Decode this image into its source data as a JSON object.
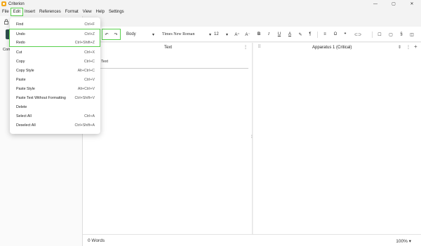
{
  "app": {
    "title": "Criterion",
    "brand_color": "#f2a81d",
    "highlight_color": "#57d04b",
    "window_controls": [
      "minimize-icon",
      "maximize-icon",
      "close-icon"
    ]
  },
  "menubar": {
    "items": [
      "File",
      "Edit",
      "Insert",
      "References",
      "Format",
      "View",
      "Help",
      "Settings"
    ],
    "active": "Edit"
  },
  "sidebar": {
    "label": "Com"
  },
  "toolbar": {
    "style": "Body",
    "font": "Times New Roman",
    "size": "12",
    "icons": [
      "undo-icon",
      "redo-icon",
      "increase-font-icon",
      "decrease-font-icon",
      "bold-icon",
      "italic-icon",
      "underline-icon",
      "font-color-icon",
      "highlight-icon",
      "pilcrow-icon",
      "align-icon",
      "omega-icon",
      "quote-icon",
      "link-icon",
      "comment-icon",
      "box-icon",
      "note-icon",
      "code-icon"
    ],
    "glyphs": {
      "increase": "A⁺",
      "decrease": "A⁻",
      "bold": "B",
      "italic": "I",
      "underline": "U",
      "color": "A",
      "pilcrow": "¶",
      "align": "≡",
      "omega": "Ω",
      "quote": "❞",
      "link": "⊂⊃",
      "comment": "☐",
      "box": "▢",
      "note": "§",
      "code": "◫"
    }
  },
  "panes": {
    "left": {
      "title": "Text",
      "content": "Text"
    },
    "right": {
      "title": "Apparatus 1 (Critical)"
    }
  },
  "status": {
    "words": "0 Words",
    "zoom": "100%"
  },
  "edit_menu": {
    "items": [
      {
        "label": "Find",
        "shortcut": "Ctrl+F"
      },
      {
        "label": "Undo",
        "shortcut": "Ctrl+Z"
      },
      {
        "label": "Redo",
        "shortcut": "Ctrl+Shift+Z"
      },
      {
        "label": "Cut",
        "shortcut": "Ctrl+X"
      },
      {
        "label": "Copy",
        "shortcut": "Ctrl+C"
      },
      {
        "label": "Copy Style",
        "shortcut": "Alt+Ctrl+C"
      },
      {
        "label": "Paste",
        "shortcut": "Ctrl+V"
      },
      {
        "label": "Paste Style",
        "shortcut": "Alt+Ctrl+V"
      },
      {
        "label": "Paste Text Without Formatting",
        "shortcut": "Ctrl+Shift+V"
      },
      {
        "label": "Delete",
        "shortcut": ""
      },
      {
        "label": "Select All",
        "shortcut": "Ctrl+A"
      },
      {
        "label": "Deselect All",
        "shortcut": "Ctrl+Shift+A"
      }
    ]
  }
}
